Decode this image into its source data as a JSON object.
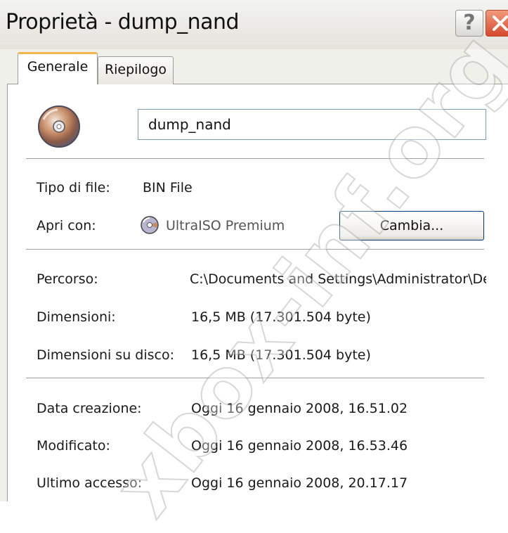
{
  "window": {
    "title": "Proprietà - dump_nand"
  },
  "title_buttons": {
    "help_label": "?",
    "help_icon": "question-icon",
    "close_icon": "close-icon",
    "close_color": "#d6482b"
  },
  "tabs": [
    {
      "label": "Generale",
      "selected": true,
      "accent": "#f2b54d"
    },
    {
      "label": "Riepilogo",
      "selected": false
    }
  ],
  "file": {
    "icon": "disc-icon",
    "name": "dump_nand"
  },
  "properties": {
    "type": {
      "label": "Tipo di file:",
      "value": "BIN File"
    },
    "open_with": {
      "label": "Apri con:",
      "value": "UltraISO Premium",
      "icon": "ultraiso-icon",
      "button_label": "Cambia..."
    },
    "path": {
      "label": "Percorso:",
      "value": "C:\\Documents and Settings\\Administrator\\De"
    },
    "size": {
      "label": "Dimensioni:",
      "value": "16,5 MB (17.301.504 byte)"
    },
    "size_on_disk": {
      "label": "Dimensioni su disco:",
      "value": "16,5 MB (17.301.504 byte)"
    },
    "created": {
      "label": "Data creazione:",
      "value": "Oggi 16 gennaio 2008, 16.51.02"
    },
    "modified": {
      "label": "Modificato:",
      "value": "Oggi 16 gennaio 2008, 16.53.46"
    },
    "accessed": {
      "label": "Ultimo accesso:",
      "value": "Oggi 16 gennaio 2008, 20.17.17"
    }
  },
  "watermark": {
    "text": "xbox-inf.org"
  }
}
